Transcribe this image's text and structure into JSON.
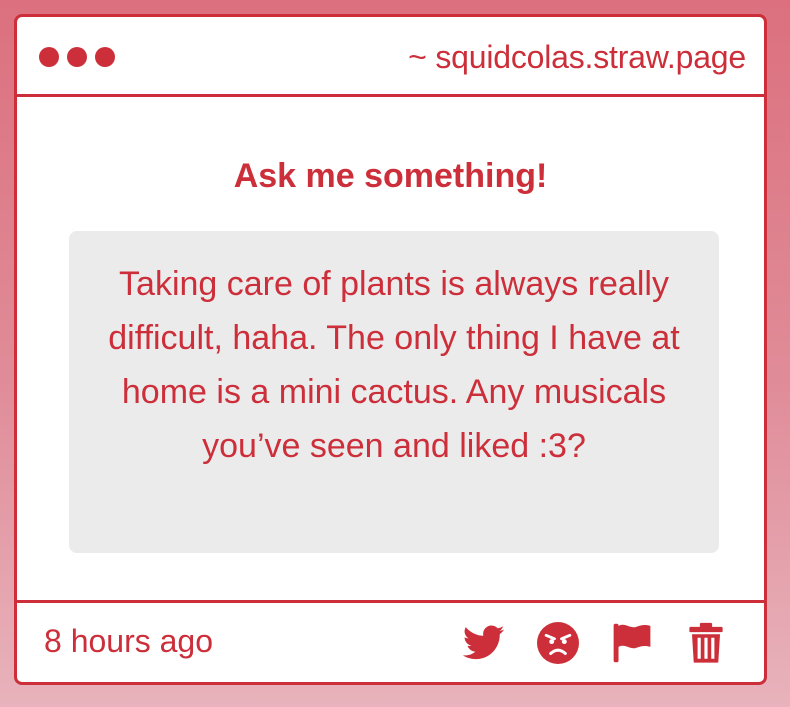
{
  "window": {
    "url": "~ squidcolas.straw.page"
  },
  "main": {
    "heading": "Ask me something!",
    "question": "Taking care of plants is always really difficult, haha. The only thing I have at home is a mini cactus. Any musicals you’ve seen and liked :3?"
  },
  "footer": {
    "timestamp": "8 hours ago",
    "icons": [
      "twitter-icon",
      "angry-face-icon",
      "flag-icon",
      "trash-icon"
    ]
  },
  "colors": {
    "accent": "#cc2f3a",
    "question_bg": "#ecebec",
    "card_bg": "#ffffff"
  }
}
